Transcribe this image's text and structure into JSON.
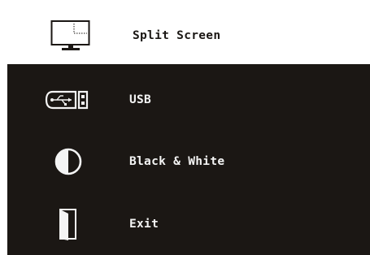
{
  "menu": {
    "items": [
      {
        "label": "Split Screen",
        "icon": "monitor-split-icon",
        "selected": true
      },
      {
        "label": "USB",
        "icon": "usb-icon",
        "selected": false
      },
      {
        "label": "Black & White",
        "icon": "contrast-icon",
        "selected": false
      },
      {
        "label": "Exit",
        "icon": "door-exit-icon",
        "selected": false
      }
    ]
  },
  "colors": {
    "background": "#1b1714",
    "selected_background": "#ffffff",
    "text": "#f4f4f4",
    "selected_text": "#1b1714"
  }
}
